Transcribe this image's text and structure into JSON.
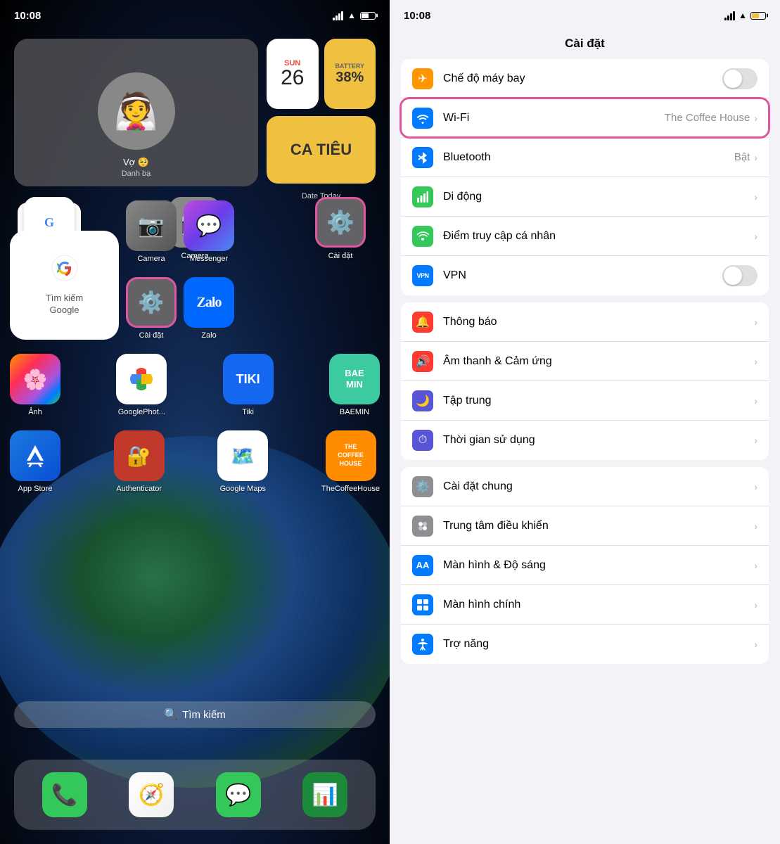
{
  "left": {
    "status": {
      "time": "10:08"
    },
    "widgets": {
      "contact_name": "Vợ 🥺",
      "label_danh_ba": "Danh bạ",
      "cal_day": "SUN",
      "cal_num": "26",
      "battery_label": "BATTERY",
      "battery_pct": "38%",
      "ca_tieu": "CA TIÊU",
      "label_date_today": "Date Today"
    },
    "apps_row1": {
      "google_label": "Google",
      "google_sub": "Tìm kiếm\nGoogle",
      "camera_label": "Camera",
      "settings_label": "Cài đặt"
    },
    "apps_row2": {
      "messenger_label": "Messenger",
      "zalo_label": "Zalo"
    },
    "apps_row3": {
      "photos_label": "Ảnh",
      "gphotos_label": "GooglePhot...",
      "tiki_label": "Tiki",
      "baemin_label": "BAEMIN",
      "baemin_text": "BAE\nMIN"
    },
    "apps_row4": {
      "appstore_label": "App Store",
      "auth_label": "Authenticator",
      "gmaps_label": "Google Maps",
      "coffee_label": "TheCoffeeHouse",
      "coffee_text": "THE\nCOFFEE\nHOUSE"
    },
    "search": {
      "placeholder": "Tìm kiếm",
      "icon": "🔍"
    },
    "dock": {
      "phone_label": "Phone",
      "safari_label": "Safari",
      "messages_label": "Messages",
      "sheets_label": "Sheets"
    }
  },
  "right": {
    "status": {
      "time": "10:08"
    },
    "title": "Cài đặt",
    "group1": [
      {
        "id": "airplane",
        "label": "Chế độ máy bay",
        "icon_text": "✈",
        "icon_color": "airplane",
        "control": "toggle",
        "value": ""
      },
      {
        "id": "wifi",
        "label": "Wi-Fi",
        "icon_text": "wifi",
        "icon_color": "wifi",
        "control": "value-chevron",
        "value": "The Coffee House",
        "highlighted": true
      },
      {
        "id": "bluetooth",
        "label": "Bluetooth",
        "icon_text": "bt",
        "icon_color": "bluetooth",
        "control": "value-chevron",
        "value": "Bật"
      },
      {
        "id": "cellular",
        "label": "Di động",
        "icon_text": "cellular",
        "icon_color": "cellular",
        "control": "chevron",
        "value": ""
      },
      {
        "id": "hotspot",
        "label": "Điểm truy cập cá nhân",
        "icon_text": "hotspot",
        "icon_color": "hotspot",
        "control": "chevron",
        "value": ""
      },
      {
        "id": "vpn",
        "label": "VPN",
        "icon_text": "VPN",
        "icon_color": "vpn",
        "control": "toggle",
        "value": ""
      }
    ],
    "group2": [
      {
        "id": "notifications",
        "label": "Thông báo",
        "icon_text": "notif",
        "icon_color": "notifications",
        "control": "chevron"
      },
      {
        "id": "sounds",
        "label": "Âm thanh & Cảm ứng",
        "icon_text": "sounds",
        "icon_color": "sounds",
        "control": "chevron"
      },
      {
        "id": "focus",
        "label": "Tập trung",
        "icon_text": "focus",
        "icon_color": "focus",
        "control": "chevron"
      },
      {
        "id": "screentime",
        "label": "Thời gian sử dụng",
        "icon_text": "screentime",
        "icon_color": "screentime",
        "control": "chevron"
      }
    ],
    "group3": [
      {
        "id": "general",
        "label": "Cài đặt chung",
        "icon_text": "general",
        "icon_color": "general",
        "control": "chevron"
      },
      {
        "id": "control",
        "label": "Trung tâm điều khiển",
        "icon_text": "control",
        "icon_color": "control",
        "control": "chevron"
      },
      {
        "id": "display",
        "label": "Màn hình & Độ sáng",
        "icon_text": "AA",
        "icon_color": "display",
        "control": "chevron"
      },
      {
        "id": "homescreen",
        "label": "Màn hình chính",
        "icon_text": "homescreen",
        "icon_color": "homescreen",
        "control": "chevron"
      },
      {
        "id": "accessibility",
        "label": "Trợ năng",
        "icon_text": "access",
        "icon_color": "accessibility",
        "control": "chevron"
      }
    ]
  }
}
